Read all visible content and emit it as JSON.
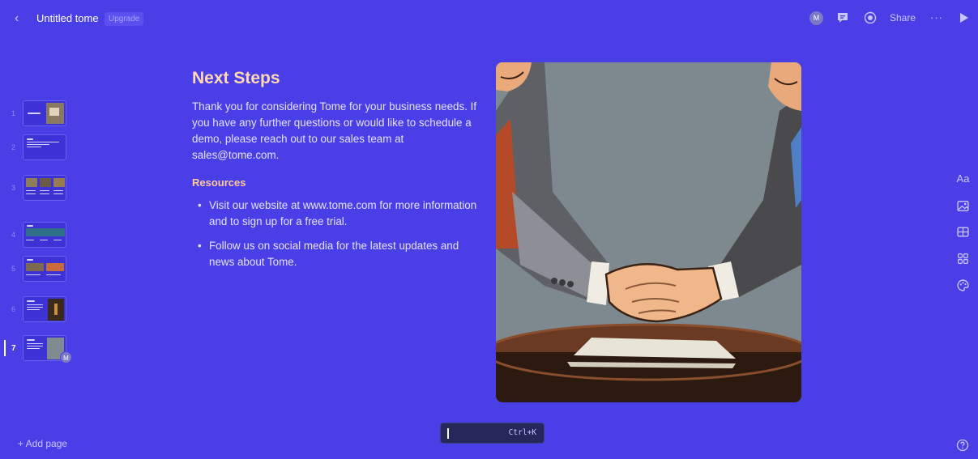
{
  "header": {
    "title": "Untitled tome",
    "upgrade_label": "Upgrade",
    "avatar_initial": "M",
    "share_label": "Share",
    "more_label": "···"
  },
  "sidebar": {
    "slides": [
      {
        "number": "1"
      },
      {
        "number": "2"
      },
      {
        "number": "3"
      },
      {
        "number": "4"
      },
      {
        "number": "5"
      },
      {
        "number": "6"
      },
      {
        "number": "7",
        "active": true,
        "avatar_initial": "M"
      }
    ],
    "add_page_label": "+ Add page"
  },
  "slide": {
    "title": "Next Steps",
    "body": "Thank you for considering Tome for your business needs. If you have any further questions or would like to schedule a demo, please reach out to our sales team at sales@tome.com.",
    "section_heading": "Resources",
    "bullets": [
      "Visit our website at www.tome.com for more information and to sign up for a free trial.",
      "Follow us on social media for the latest updates and news about Tome."
    ]
  },
  "tools": {
    "text_label": "Aa"
  },
  "command_bar": {
    "shortcut": "Ctrl+K"
  },
  "colors": {
    "background": "#4a3fe6",
    "title": "#ffd9b3",
    "heading": "#ffc99a",
    "command_bar": "#26285c"
  }
}
